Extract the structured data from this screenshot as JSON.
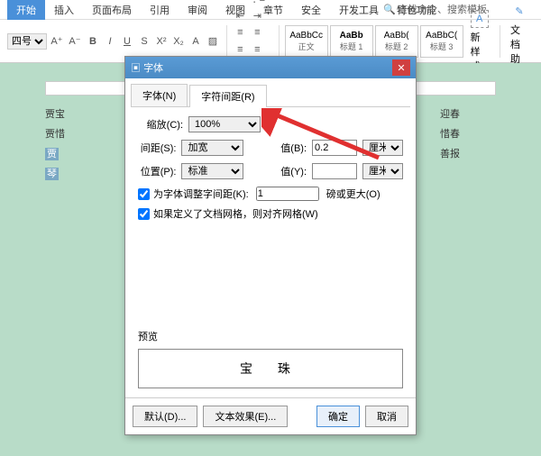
{
  "ribbon": {
    "tabs": [
      "开始",
      "插入",
      "页面布局",
      "引用",
      "审阅",
      "视图",
      "章节",
      "安全",
      "开发工具",
      "特色功能"
    ],
    "search": "查找命令、搜索模板",
    "font_size": "四号",
    "styles": [
      {
        "preview": "AaBbCc",
        "label": "正文"
      },
      {
        "preview": "AaBb",
        "label": "标题 1"
      },
      {
        "preview": "AaBb(",
        "label": "标题 2"
      },
      {
        "preview": "AaBbC(",
        "label": "标题 3"
      }
    ],
    "new_style": "新样式",
    "doc_helper": "文档助手"
  },
  "doc": {
    "line1a": "贾宝",
    "line1b": "迎春",
    "line2a": "贾惜",
    "line2b": "惜春",
    "line3a": "贾",
    "line3b": "善报",
    "line4": "琴"
  },
  "dialog": {
    "title": "字体",
    "tabs": [
      "字体(N)",
      "字符间距(R)"
    ],
    "scale_label": "缩放(C):",
    "scale_value": "100%",
    "spacing_label": "间距(S):",
    "spacing_value": "加宽",
    "position_label": "位置(P):",
    "position_value": "标准",
    "value_b_label": "值(B):",
    "value_b": "0.2",
    "unit_b": "厘米",
    "value_y_label": "值(Y):",
    "value_y": "",
    "unit_y": "厘米",
    "kerning_label": "为字体调整字间距(K):",
    "kerning_value": "1",
    "kerning_unit": "磅或更大(O)",
    "snap_label": "如果定义了文档网格，则对齐网格(W)",
    "preview_label": "预览",
    "preview_text": "宝 珠",
    "default_btn": "默认(D)...",
    "text_effect_btn": "文本效果(E)...",
    "ok_btn": "确定",
    "cancel_btn": "取消"
  }
}
